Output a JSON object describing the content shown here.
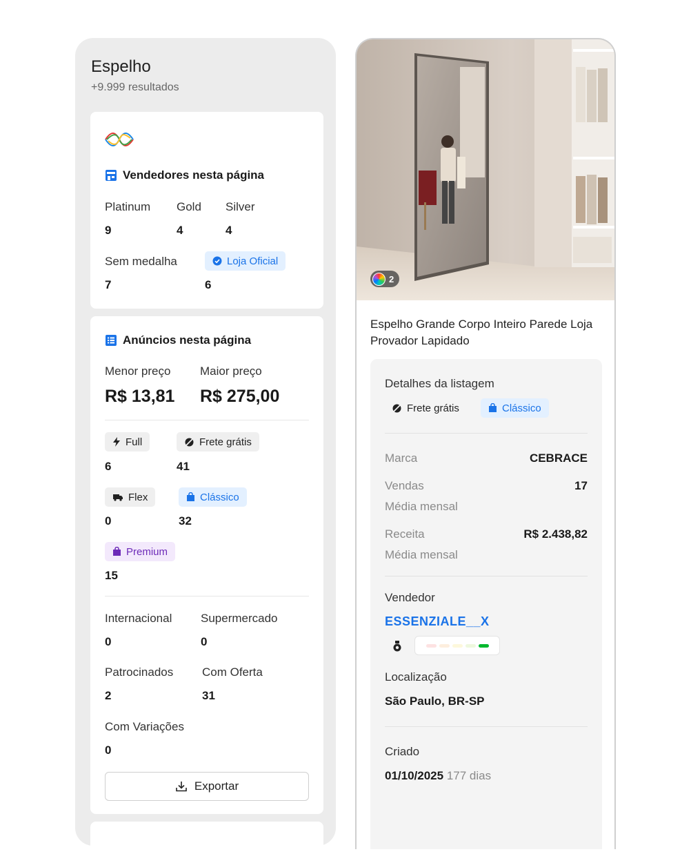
{
  "search": {
    "query": "Espelho",
    "results_count": "+9.999 resultados"
  },
  "sellers_card": {
    "logo_icon": "brand-wave-logo",
    "title": "Vendedores nesta página",
    "platinum_label": "Platinum",
    "platinum_value": "9",
    "gold_label": "Gold",
    "gold_value": "4",
    "silver_label": "Silver",
    "silver_value": "4",
    "no_medal_label": "Sem medalha",
    "no_medal_value": "7",
    "official_store_label": "Loja Oficial",
    "official_store_value": "6"
  },
  "ads_card": {
    "title": "Anúncios nesta página",
    "min_price_label": "Menor preço",
    "min_price_value": "R$ 13,81",
    "max_price_label": "Maior preço",
    "max_price_value": "R$ 275,00",
    "full_label": "Full",
    "full_value": "6",
    "free_shipping_label": "Frete grátis",
    "free_shipping_value": "41",
    "flex_label": "Flex",
    "flex_value": "0",
    "classic_label": "Clássico",
    "classic_value": "32",
    "premium_label": "Premium",
    "premium_value": "15",
    "international_label": "Internacional",
    "international_value": "0",
    "supermarket_label": "Supermercado",
    "supermarket_value": "0",
    "sponsored_label": "Patrocinados",
    "sponsored_value": "2",
    "with_offer_label": "Com Oferta",
    "with_offer_value": "31",
    "with_variations_label": "Com Variações",
    "with_variations_value": "0",
    "export_label": "Exportar"
  },
  "product": {
    "variants_count": "2",
    "title": "Espelho Grande Corpo Inteiro Parede Loja Provador Lapidado",
    "details_title": "Detalhes da listagem",
    "free_shipping_tag": "Frete grátis",
    "listing_type_tag": "Clássico",
    "brand_label": "Marca",
    "brand_value": "CEBRACE",
    "sales_label": "Vendas",
    "sales_sub": "Média mensal",
    "sales_value": "17",
    "revenue_label": "Receita",
    "revenue_sub": "Média mensal",
    "revenue_value": "R$ 2.438,82",
    "seller_label": "Vendedor",
    "seller_name": "ESSENZIALE__X",
    "reputation_level": 5,
    "location_label": "Localização",
    "location_value": "São Paulo, BR-SP",
    "created_label": "Criado",
    "created_date": "01/10/2025",
    "created_age": "177 dias"
  },
  "colors": {
    "accent_blue": "#1a73e8",
    "premium_purple": "#6d2bb8",
    "panel_gray": "#ececec"
  }
}
